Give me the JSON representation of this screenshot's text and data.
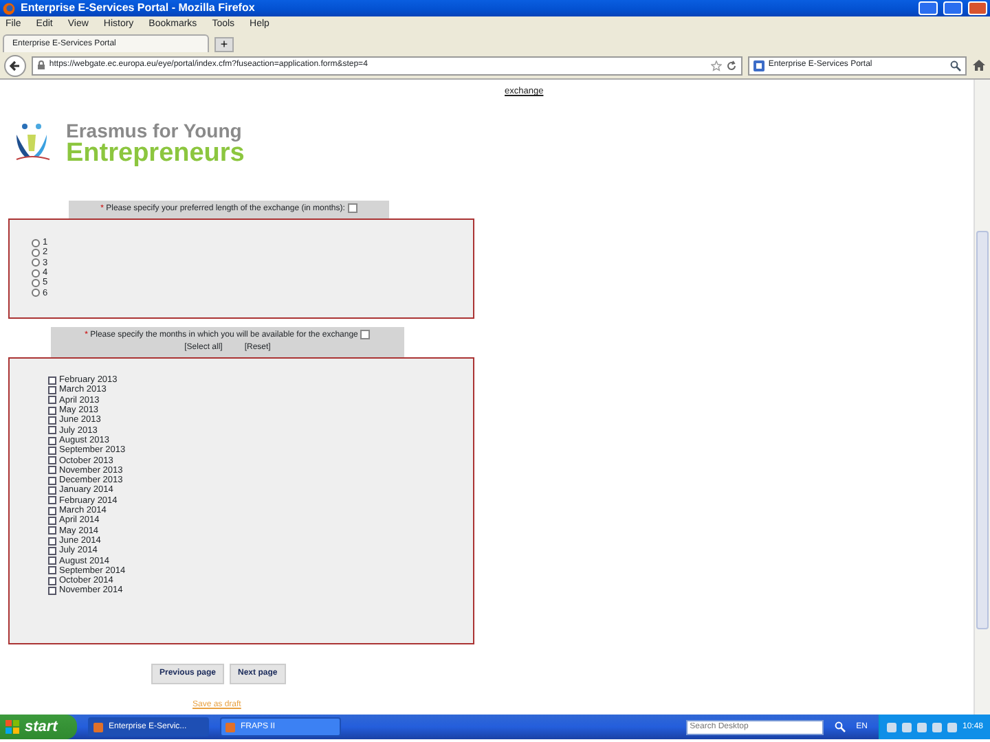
{
  "window": {
    "title": "Enterprise E-Services Portal - Mozilla Firefox"
  },
  "menu": [
    "File",
    "Edit",
    "View",
    "History",
    "Bookmarks",
    "Tools",
    "Help"
  ],
  "tabs": [
    {
      "label": "Enterprise E-Services Portal",
      "selected": true
    }
  ],
  "new_tab": "+",
  "address_bar": {
    "url": "https://webgate.ec.europa.eu/eye/portal/index.cfm?fuseaction=application.form&step=4"
  },
  "search": {
    "value": "Enterprise E-Services Portal"
  },
  "page": {
    "top_link": "exchange",
    "logo": {
      "line_1": "Erasmus for Young",
      "line_2": "Entrepreneurs"
    },
    "questions": [
      {
        "kind": "radio",
        "required_mark": "*",
        "label": "Please specify your preferred length of the exchange (in months):",
        "options": [
          {
            "label": "1",
            "checked": false
          },
          {
            "label": "2",
            "checked": false
          },
          {
            "label": "3",
            "checked": false
          },
          {
            "label": "4",
            "checked": false
          },
          {
            "label": "5",
            "checked": false
          },
          {
            "label": "6",
            "checked": false
          }
        ]
      },
      {
        "kind": "checkbox",
        "required_mark": "*",
        "label": "Please specify the months in which you will be available for the exchange",
        "actions": [
          "[Select all]",
          "[Reset]"
        ],
        "options": [
          {
            "label": "February 2013",
            "checked": false
          },
          {
            "label": "March 2013",
            "checked": false
          },
          {
            "label": "April 2013",
            "checked": false
          },
          {
            "label": "May 2013",
            "checked": false
          },
          {
            "label": "June 2013",
            "checked": false
          },
          {
            "label": "July 2013",
            "checked": false
          },
          {
            "label": "August 2013",
            "checked": false
          },
          {
            "label": "September 2013",
            "checked": false
          },
          {
            "label": "October 2013",
            "checked": false
          },
          {
            "label": "November 2013",
            "checked": false
          },
          {
            "label": "December 2013",
            "checked": false
          },
          {
            "label": "January 2014",
            "checked": false
          },
          {
            "label": "February 2014",
            "checked": false
          },
          {
            "label": "March 2014",
            "checked": false
          },
          {
            "label": "April 2014",
            "checked": false
          },
          {
            "label": "May 2014",
            "checked": false
          },
          {
            "label": "June 2014",
            "checked": false
          },
          {
            "label": "July 2014",
            "checked": false
          },
          {
            "label": "August 2014",
            "checked": false
          },
          {
            "label": "September 2014",
            "checked": false
          },
          {
            "label": "October 2014",
            "checked": false
          },
          {
            "label": "November 2014",
            "checked": false
          }
        ]
      }
    ],
    "buttons": [
      "Previous page",
      "Next page"
    ],
    "footer_link": "Save as draft"
  },
  "taskbar": {
    "start": "start",
    "tasks": [
      {
        "label": "Enterprise E-Servic...",
        "selected": true
      },
      {
        "label": "FRAPS II",
        "selected": false
      }
    ],
    "search_placeholder": "Search Desktop",
    "language": "EN",
    "time": "10:48"
  }
}
